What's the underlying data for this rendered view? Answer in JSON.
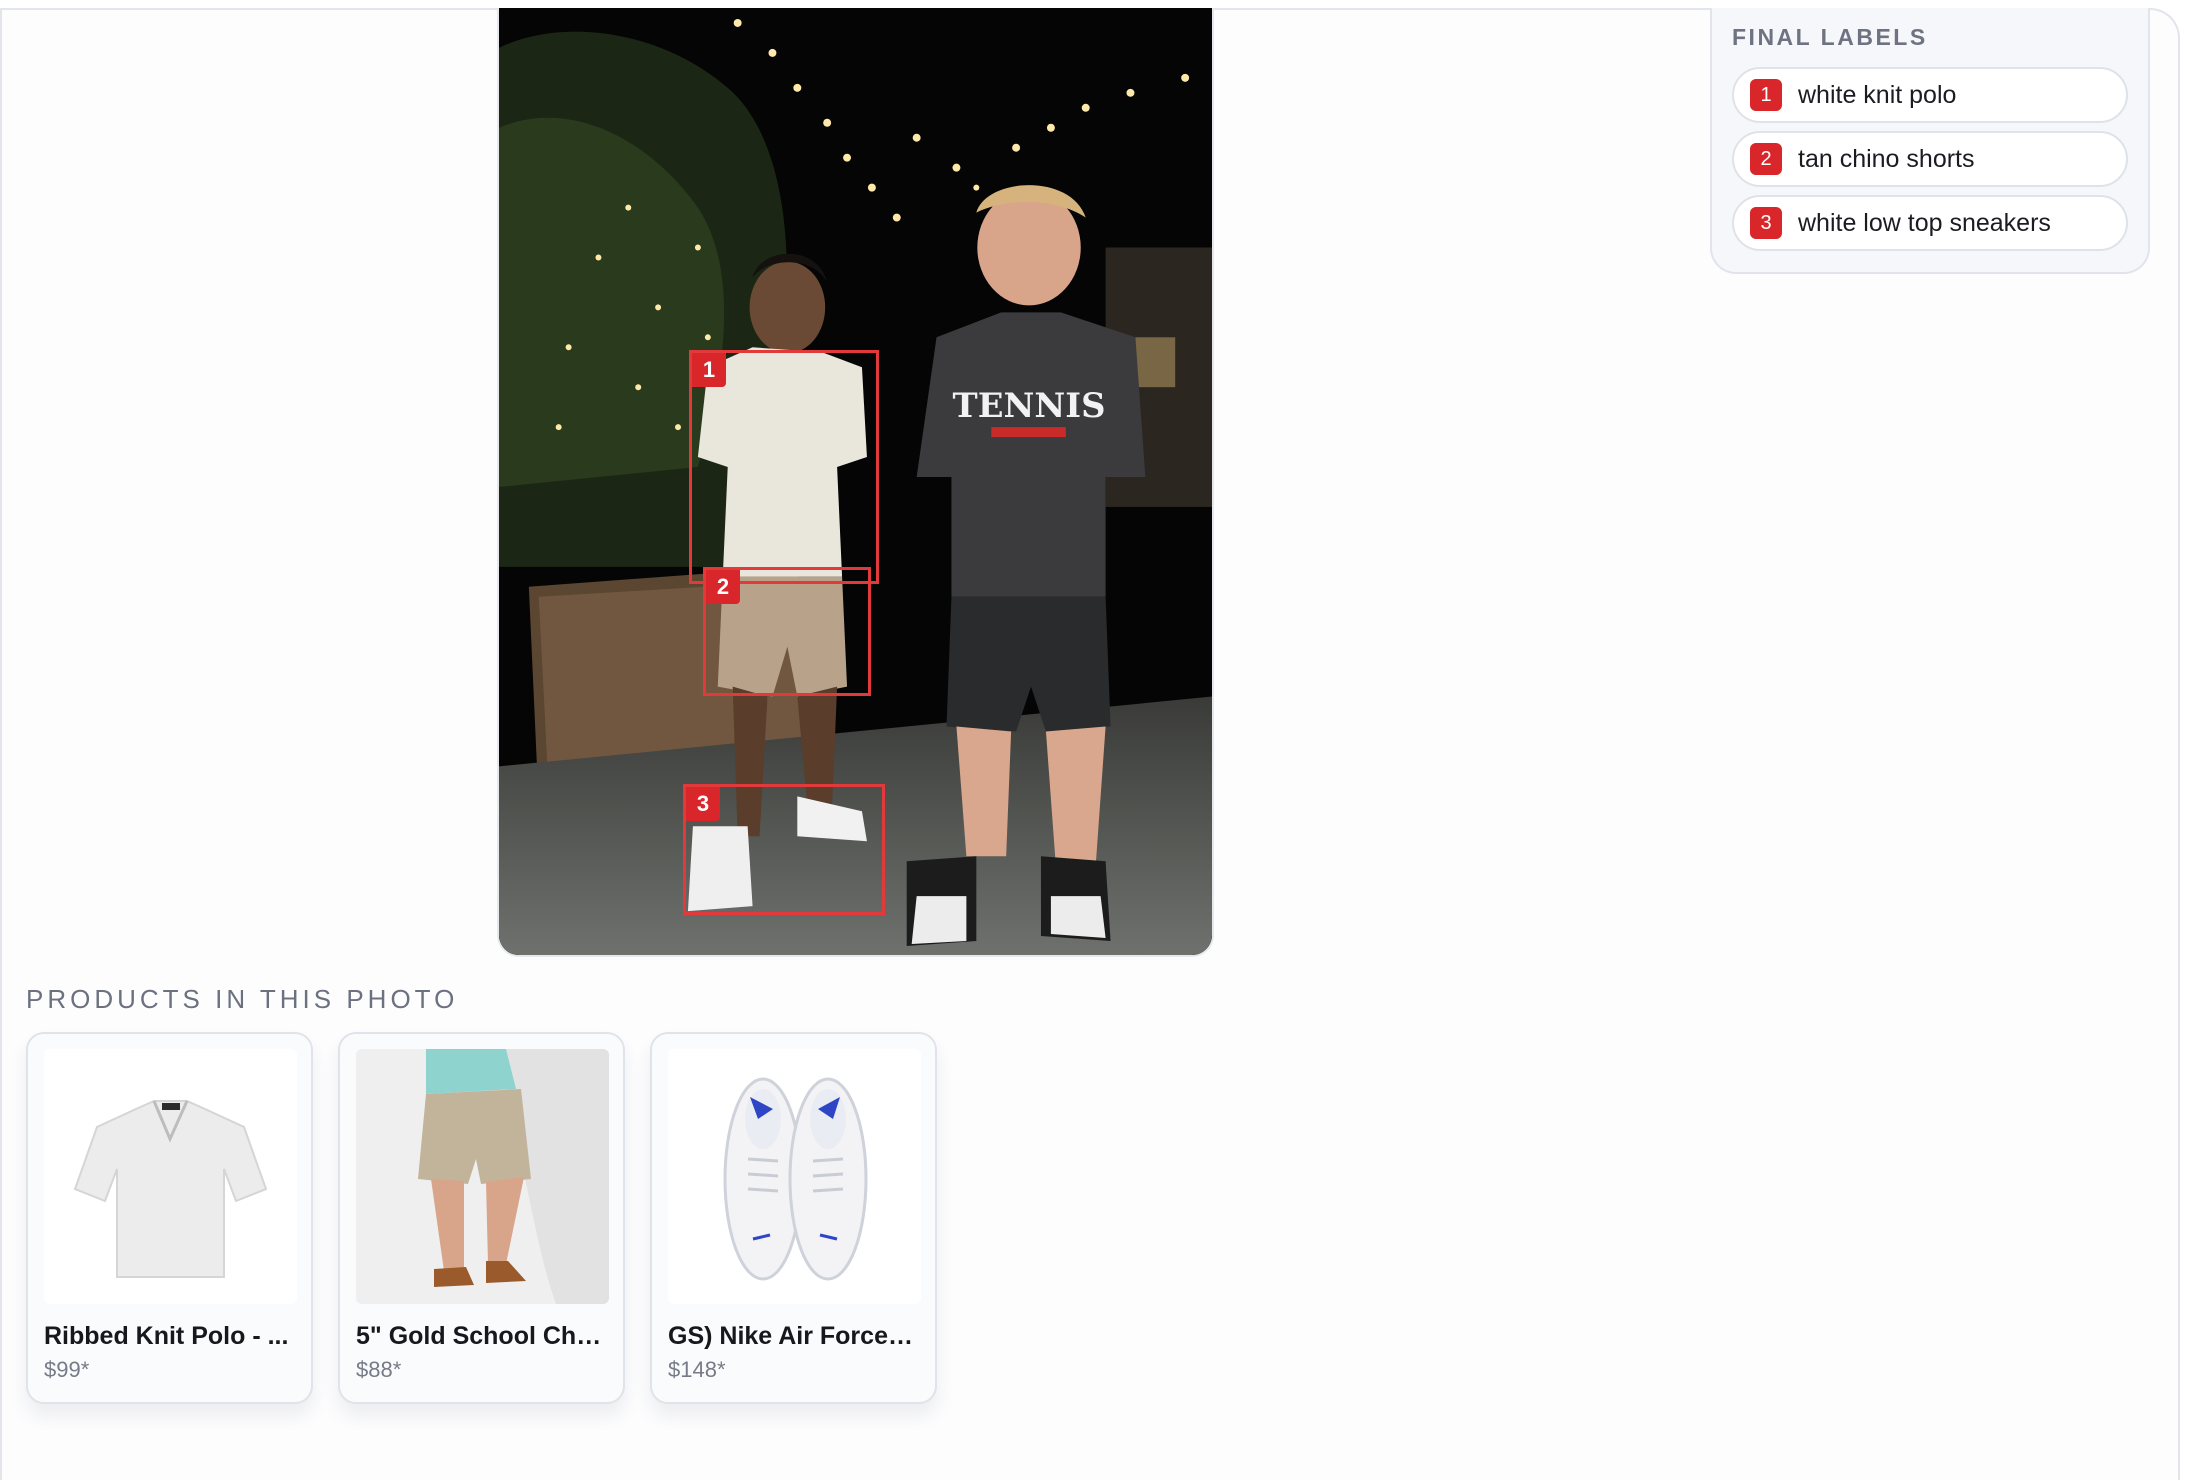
{
  "labels_panel": {
    "title": "FINAL LABELS",
    "items": [
      {
        "number": "1",
        "label": "white knit polo"
      },
      {
        "number": "2",
        "label": "tan chino shorts"
      },
      {
        "number": "3",
        "label": "white low top sneakers"
      }
    ]
  },
  "photo": {
    "detections": [
      {
        "number": "1"
      },
      {
        "number": "2"
      },
      {
        "number": "3"
      }
    ],
    "shirt_print": "TENNIS"
  },
  "products": {
    "heading": "PRODUCTS IN THIS PHOTO",
    "items": [
      {
        "name": "Ribbed Knit Polo - ...",
        "price": "$99*",
        "image_icon": "polo-shirt-image"
      },
      {
        "name": "5\" Gold School Chin...",
        "price": "$88*",
        "image_icon": "chino-shorts-image"
      },
      {
        "name": "GS) Nike Air Force 1 ...",
        "price": "$148*",
        "image_icon": "sneakers-image"
      }
    ]
  },
  "colors": {
    "accent_red": "#d9262b",
    "box_red": "#e23a3a"
  }
}
